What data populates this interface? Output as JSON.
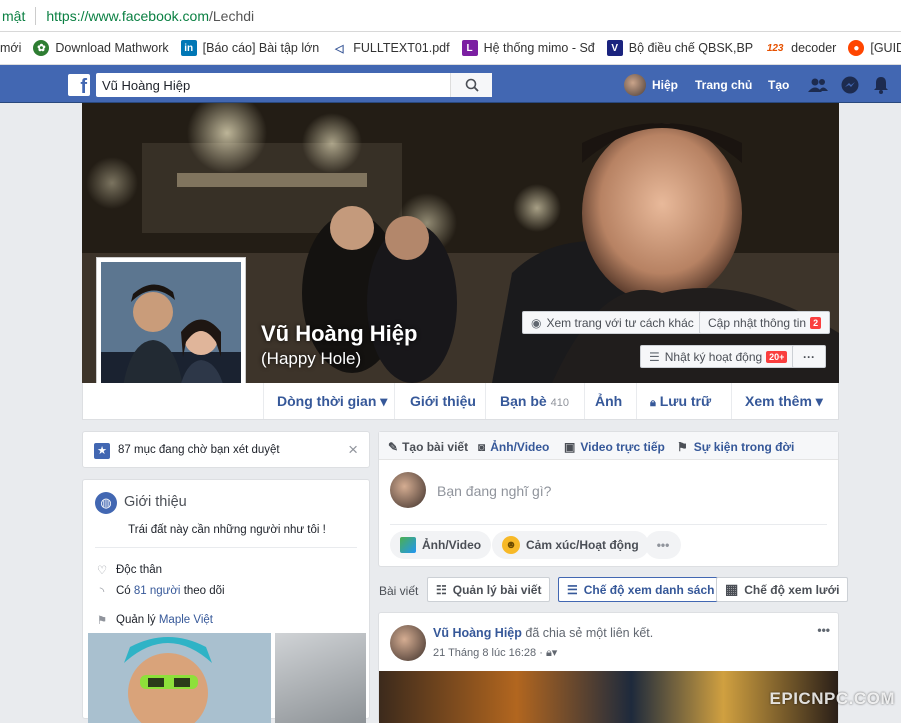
{
  "browser": {
    "security_text": "mật",
    "url_scheme": "https://",
    "url_host": "www.facebook.com",
    "url_path": "/Lechdi"
  },
  "bookmarks": [
    {
      "label": "mới",
      "icon": "none"
    },
    {
      "label": "Download Mathwork",
      "icon": "leaf-icon"
    },
    {
      "label": "[Báo cáo] Bài tập lớn",
      "icon": "linkedin-icon"
    },
    {
      "label": "FULLTEXT01.pdf",
      "icon": "diva-icon"
    },
    {
      "label": "Hệ thống mimo - Sđ",
      "icon": "purple-l-icon"
    },
    {
      "label": "Bộ điều chế QBSK,BP",
      "icon": "v-logo-icon"
    },
    {
      "label": "decoder",
      "icon": "123-icon"
    },
    {
      "label": "[GUIDE] A",
      "icon": "reddit-icon"
    }
  ],
  "fb_header": {
    "search_value": "Vũ Hoàng Hiệp",
    "user_name": "Hiệp",
    "home": "Trang chủ",
    "create": "Tạo"
  },
  "profile": {
    "name": "Vũ Hoàng Hiệp",
    "alternate_name": "(Happy Hole)"
  },
  "cover_buttons": {
    "view_as": "Xem trang với tư cách khác",
    "update_info": "Cập nhật thông tin",
    "update_badge": "2",
    "activity_log": "Nhật ký hoạt động",
    "activity_badge": "20+",
    "more": "···"
  },
  "tabs": [
    {
      "label": "Dòng thời gian ▾"
    },
    {
      "label": "Giới thiệu"
    },
    {
      "label": "Bạn bè",
      "count": "410"
    },
    {
      "label": "Ảnh"
    },
    {
      "label": "Lưu trữ"
    },
    {
      "label": "Xem thêm ▾"
    }
  ],
  "pending": {
    "text": "87 mục đang chờ bạn xét duyệt",
    "close": "×"
  },
  "intro": {
    "title": "Giới thiệu",
    "bio": "Trái đất này cần những người như tôi !",
    "relationship": "Độc thân",
    "followers_prefix": "Có",
    "followers_link": "81 người",
    "followers_suffix": "theo dõi",
    "manage_prefix": "Quản lý",
    "manage_link": "Maple Việt"
  },
  "composer": {
    "tab_post": "Tạo bài viết",
    "tab_photo": "Ảnh/Video",
    "tab_live": "Video trực tiếp",
    "tab_event": "Sự kiện trong đời",
    "placeholder": "Bạn đang nghĩ gì?",
    "photo_btn": "Ảnh/Video",
    "feeling_btn": "Cảm xúc/Hoạt động",
    "more": "•••"
  },
  "posts_bar": {
    "label": "Bài viết",
    "manage": "Quản lý bài viết",
    "list_view": "Chế độ xem danh sách",
    "grid_view": "Chế độ xem lưới"
  },
  "post": {
    "author": "Vũ Hoàng Hiệp",
    "action": "đã chia sẻ một liên kết.",
    "time": "21 Tháng 8 lúc 16:28 ·",
    "more": "•••"
  },
  "watermark": "EPICNPC.COM",
  "colors": {
    "fb_blue": "#4267b2",
    "link": "#365899",
    "badge_red": "#fa3e3e",
    "secure_green": "#0b8043"
  }
}
